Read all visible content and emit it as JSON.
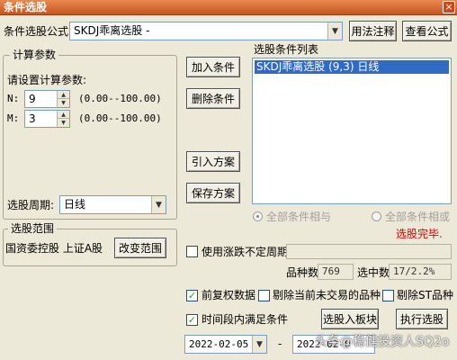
{
  "window": {
    "title": "条件选股",
    "close_label": "×"
  },
  "formula": {
    "label": "条件选股公式",
    "value": "SKDJ乖离选股 -",
    "usage_button": "用法注释",
    "view_button": "查看公式"
  },
  "params": {
    "group_title": "计算参数",
    "prompt": "请设置计算参数:",
    "items": [
      {
        "name": "N:",
        "value": "9",
        "range": "(0.00--100.00)"
      },
      {
        "name": "M:",
        "value": "3",
        "range": "(0.00--100.00)"
      }
    ],
    "period_label": "选股周期:",
    "period_value": "日线"
  },
  "actions": {
    "add": "加入条件",
    "delete": "删除条件",
    "import_plan": "引入方案",
    "save_plan": "保存方案"
  },
  "conditions": {
    "title": "选股条件列表",
    "items": [
      "SKDJ乖离选股 (9,3) 日线"
    ],
    "logic_and": "全部条件相与",
    "logic_or": "全部条件相或",
    "status": "选股完毕."
  },
  "scope": {
    "group_title": "选股范围",
    "value": "国资委控股 上证A股",
    "change_button": "改变范围"
  },
  "options": {
    "variable_period_label": "使用涨跌不定周期",
    "variable_period_checked": false,
    "count_label": "品种数",
    "count_value": "769",
    "hits_label": "选中数",
    "hits_value": "17/2.2%",
    "pre_adjust_label": "前复权数据",
    "pre_adjust_checked": true,
    "exclude_untraded_label": "剔除当前未交易的品种",
    "exclude_untraded_checked": false,
    "exclude_st_label": "剔除ST品种",
    "exclude_st_checked": false,
    "time_range_label": "时间段内满足条件",
    "time_range_checked": true,
    "to_board_button": "选股入板块",
    "run_button": "执行选股",
    "start_date": "2022-02-05",
    "separator": "-",
    "end_date": "2022-02-0",
    "check_mark": "✓"
  },
  "watermark": "头条@稳健投资人SQ2o",
  "colors": {
    "title_bar": "#c7551f",
    "selection": "#316ac5",
    "status_red": "#e00000",
    "check_green": "#21a121"
  }
}
